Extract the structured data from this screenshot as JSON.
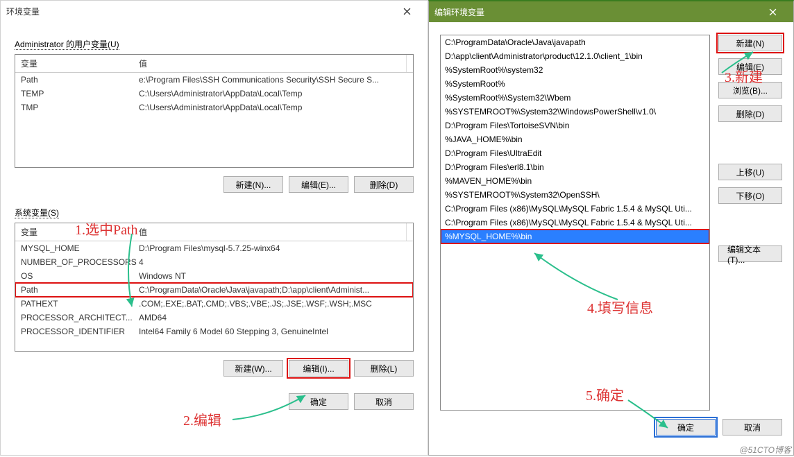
{
  "left": {
    "title": "环境变量",
    "user_section_label": "Administrator 的用户变量(U)",
    "cols": {
      "var": "变量",
      "val": "值"
    },
    "user_vars": [
      {
        "name": "Path",
        "value": "e:\\Program Files\\SSH Communications Security\\SSH Secure S..."
      },
      {
        "name": "TEMP",
        "value": "C:\\Users\\Administrator\\AppData\\Local\\Temp"
      },
      {
        "name": "TMP",
        "value": "C:\\Users\\Administrator\\AppData\\Local\\Temp"
      }
    ],
    "user_btns": {
      "new": "新建(N)...",
      "edit": "编辑(E)...",
      "del": "删除(D)"
    },
    "sys_section_label": "系统变量(S)",
    "sys_vars": [
      {
        "name": "MYSQL_HOME",
        "value": "D:\\Program Files\\mysql-5.7.25-winx64"
      },
      {
        "name": "NUMBER_OF_PROCESSORS",
        "value": "4"
      },
      {
        "name": "OS",
        "value": "Windows NT"
      },
      {
        "name": "Path",
        "value": "C:\\ProgramData\\Oracle\\Java\\javapath;D:\\app\\client\\Administ..."
      },
      {
        "name": "PATHEXT",
        "value": ".COM;.EXE;.BAT;.CMD;.VBS;.VBE;.JS;.JSE;.WSF;.WSH;.MSC"
      },
      {
        "name": "PROCESSOR_ARCHITECT...",
        "value": "AMD64"
      },
      {
        "name": "PROCESSOR_IDENTIFIER",
        "value": "Intel64 Family 6 Model 60 Stepping 3, GenuineIntel"
      }
    ],
    "sys_sel_index": 3,
    "sys_btns": {
      "new": "新建(W)...",
      "edit": "编辑(I)...",
      "del": "删除(L)"
    },
    "bottom": {
      "ok": "确定",
      "cancel": "取消"
    }
  },
  "right": {
    "title": "编辑环境变量",
    "paths": [
      "C:\\ProgramData\\Oracle\\Java\\javapath",
      "D:\\app\\client\\Administrator\\product\\12.1.0\\client_1\\bin",
      "%SystemRoot%\\system32",
      "%SystemRoot%",
      "%SystemRoot%\\System32\\Wbem",
      "%SYSTEMROOT%\\System32\\WindowsPowerShell\\v1.0\\",
      "D:\\Program Files\\TortoiseSVN\\bin",
      "%JAVA_HOME%\\bin",
      "D:\\Program Files\\UltraEdit",
      "D:\\Program Files\\erl8.1\\bin",
      "%MAVEN_HOME%\\bin",
      "%SYSTEMROOT%\\System32\\OpenSSH\\",
      "C:\\Program Files (x86)\\MySQL\\MySQL Fabric 1.5.4 & MySQL Uti...",
      "C:\\Program Files (x86)\\MySQL\\MySQL Fabric 1.5.4 & MySQL Uti...",
      "%MYSQL_HOME%\\bin"
    ],
    "sel_index": 14,
    "side": {
      "new": "新建(N)",
      "edit": "编辑(E)",
      "browse": "浏览(B)...",
      "delete": "删除(D)",
      "up": "上移(U)",
      "down": "下移(O)",
      "edittext": "编辑文本(T)..."
    },
    "bottom": {
      "ok": "确定",
      "cancel": "取消"
    }
  },
  "annot": {
    "a1": "1.选中Path",
    "a2": "2.编辑",
    "a3": "3.新建",
    "a4": "4.填写信息",
    "a5": "5.确定"
  },
  "watermark": "@51CTO博客"
}
